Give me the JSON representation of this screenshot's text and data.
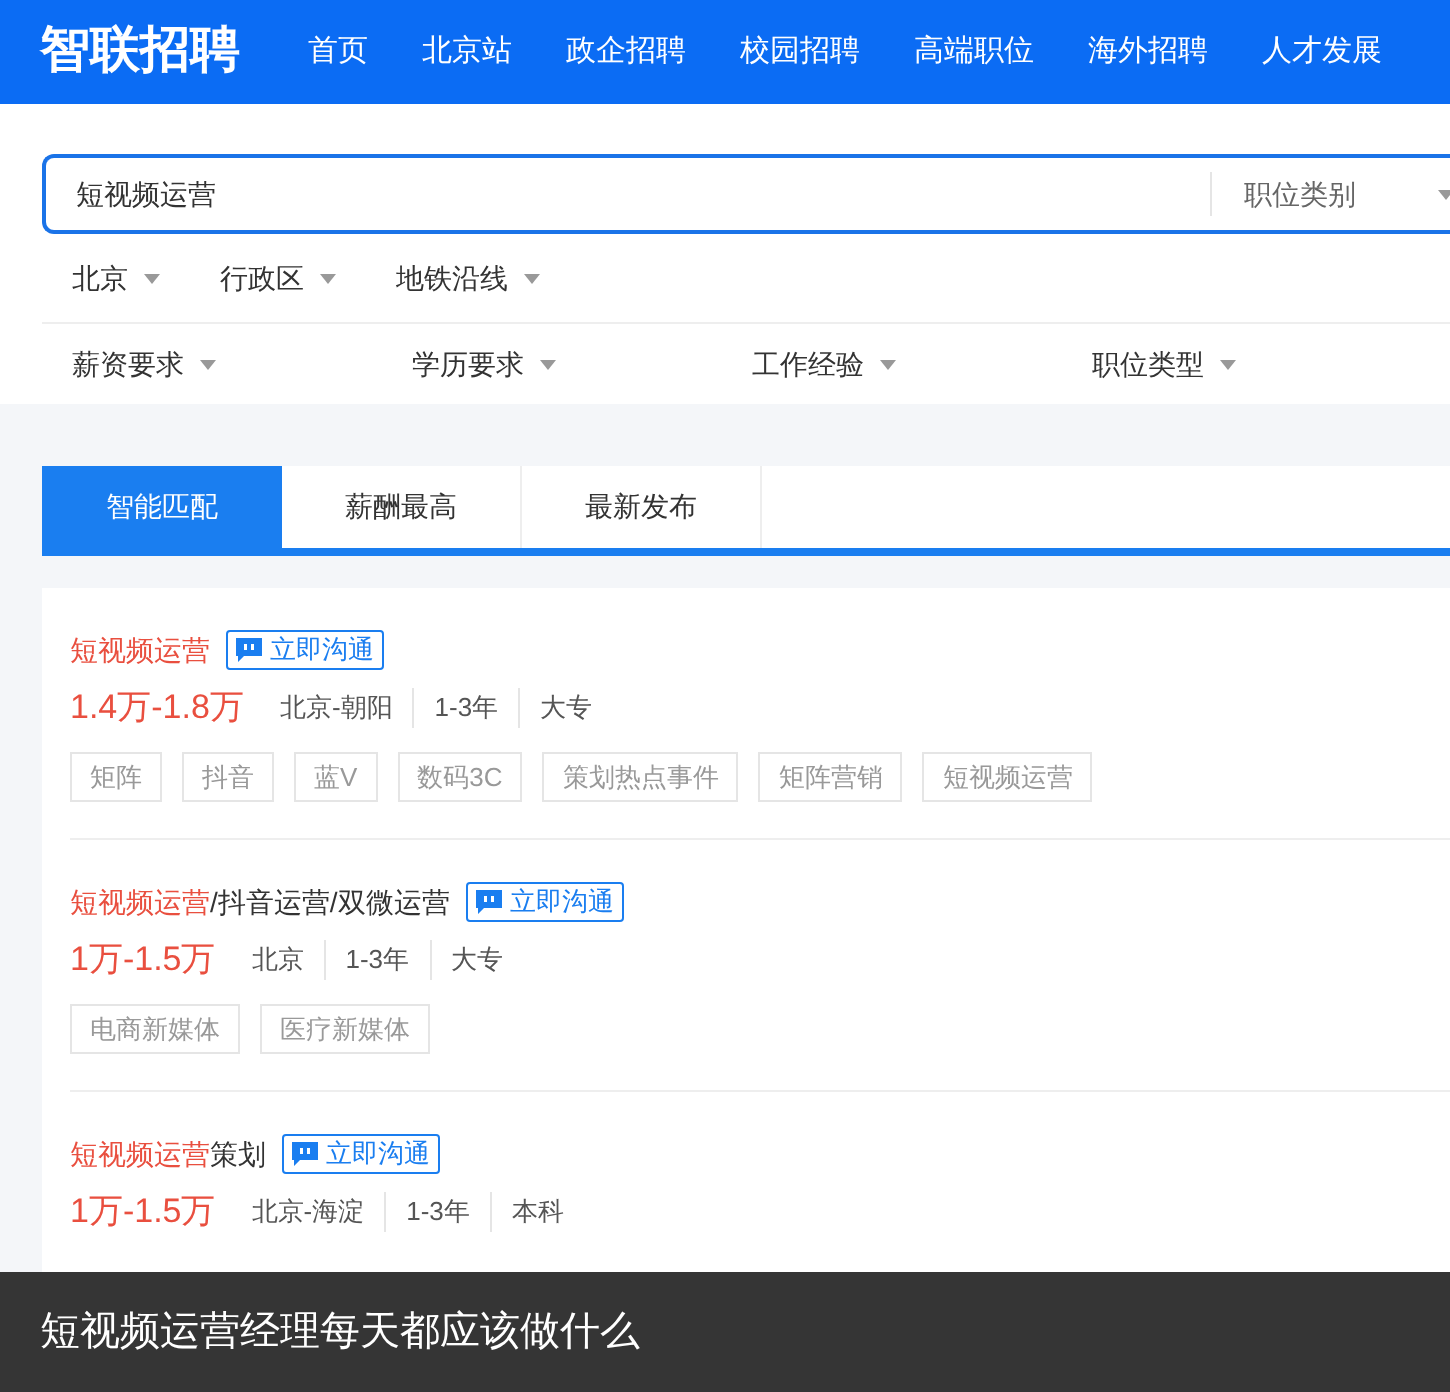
{
  "logo": "智联招聘",
  "nav": [
    "首页",
    "北京站",
    "政企招聘",
    "校园招聘",
    "高端职位",
    "海外招聘",
    "人才发展"
  ],
  "search": {
    "value": "短视频运营",
    "category": "职位类别"
  },
  "location_filters": [
    "北京",
    "行政区",
    "地铁沿线"
  ],
  "filters": [
    "薪资要求",
    "学历要求",
    "工作经验",
    "职位类型"
  ],
  "tabs": [
    {
      "label": "智能匹配",
      "selected": true
    },
    {
      "label": "薪酬最高",
      "selected": false
    },
    {
      "label": "最新发布",
      "selected": false
    }
  ],
  "jobs": [
    {
      "title_keyword": "短视频运营",
      "chat": "立即沟通",
      "salary": "1.4万-1.8万",
      "meta": [
        "北京-朝阳",
        "1-3年",
        "大专"
      ],
      "tags": [
        "矩阵",
        "抖音",
        "蓝V",
        "数码3C",
        "策划热点事件",
        "矩阵营销",
        "短视频运营"
      ]
    },
    {
      "title_keyword": "短视频运营",
      "title_rest": "/抖音运营/双微运营",
      "chat": "立即沟通",
      "salary": "1万-1.5万",
      "meta": [
        "北京",
        "1-3年",
        "大专"
      ],
      "tags": [
        "电商新媒体",
        "医疗新媒体"
      ]
    },
    {
      "title_keyword": "短视频运营",
      "title_rest": "策划",
      "chat": "立即沟通",
      "salary": "1万-1.5万",
      "meta": [
        "北京-海淀",
        "1-3年",
        "本科"
      ]
    }
  ],
  "caption": "短视频运营经理每天都应该做什么"
}
